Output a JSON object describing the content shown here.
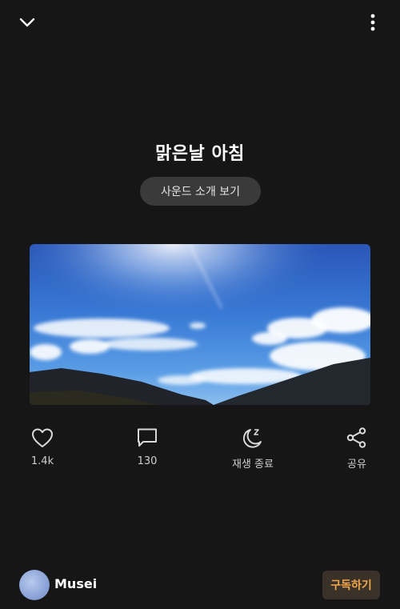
{
  "header": {
    "back_icon": "chevron-down-icon",
    "more_icon": "more-vertical-icon"
  },
  "sound": {
    "title": "맑은날 아침",
    "intro_button": "사운드 소개 보기",
    "image": "blue-sky-clouds-mountains"
  },
  "actions": {
    "like": {
      "icon": "heart-icon",
      "label": "1.4k"
    },
    "comment": {
      "icon": "comment-icon",
      "label": "130"
    },
    "sleep_timer": {
      "icon": "moon-zz-icon",
      "label": "재생 종료"
    },
    "share": {
      "icon": "share-icon",
      "label": "공유"
    }
  },
  "creator": {
    "name": "Musei",
    "subscribe_label": "구독하기"
  },
  "colors": {
    "background": "#161616",
    "accent": "#f0a64a",
    "pill": "#3a3a3a"
  }
}
